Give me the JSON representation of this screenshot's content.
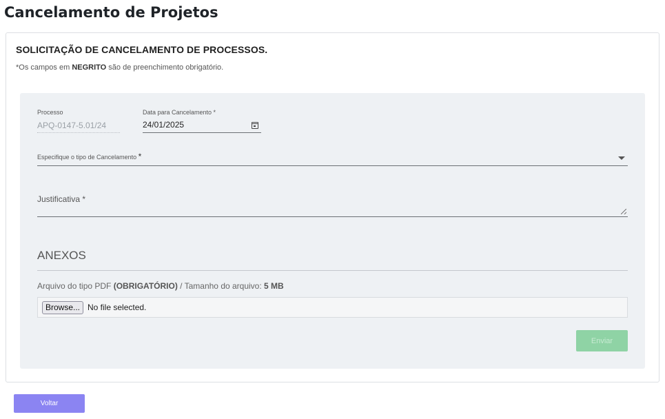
{
  "page": {
    "title": "Cancelamento de Projetos"
  },
  "card": {
    "heading": "SOLICITAÇÃO DE CANCELAMENTO DE PROCESSOS.",
    "note_prefix": "*Os campos em ",
    "note_bold": "NEGRITO",
    "note_suffix": " são de preenchimento obrigatório."
  },
  "form": {
    "process_label": "Processo",
    "process_value": "APQ-0147-5.01/24",
    "date_label": "Data para Cancelamento *",
    "date_value": "24/01/2025",
    "cancel_type_label": "Especifique o tipo de Cancelamento",
    "cancel_type_required": "*",
    "justification_label": "Justificativa *",
    "submit_label": "Enviar"
  },
  "anexos": {
    "title": "ANEXOS",
    "hint_prefix": "Arquivo do tipo PDF ",
    "hint_bold": "(OBRIGATÓRIO)",
    "hint_middle": " / Tamanho do arquivo: ",
    "hint_size": "5 MB",
    "browse_label": "Browse...",
    "file_status": "No file selected."
  },
  "footer": {
    "back_label": "Voltar"
  },
  "icons": {
    "date": "calendar-icon",
    "dropdown": "chevron-down-icon",
    "resize": "resize-handle-icon"
  },
  "colors": {
    "panel_bg": "#eef1f4",
    "submit_bg": "#8fd3a5",
    "back_bg": "#8b84f2"
  }
}
